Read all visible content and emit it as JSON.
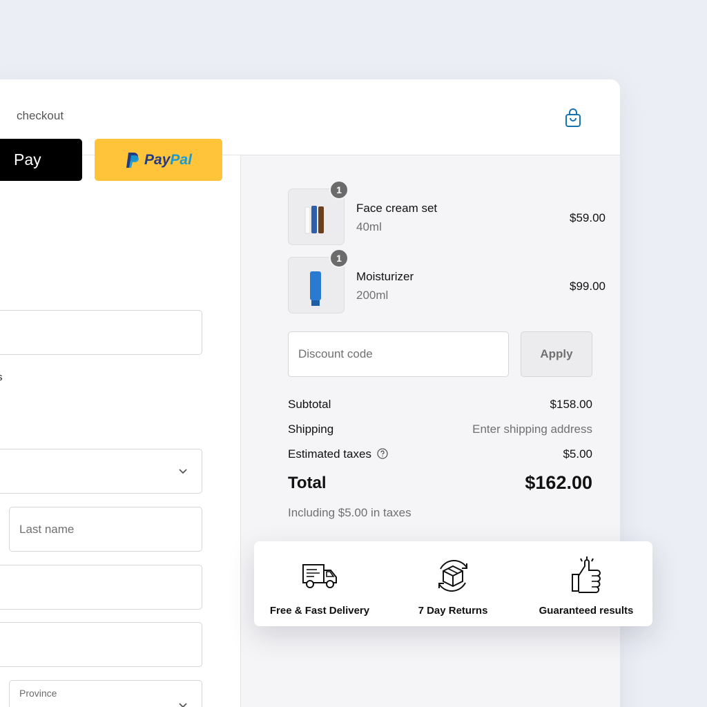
{
  "express": {
    "label": "checkout",
    "apple_pay_label": "Pay",
    "paypal_label_1": "Pay",
    "paypal_label_2": "Pal"
  },
  "form": {
    "newsletter_fragment": "s",
    "last_name_placeholder": "Last name",
    "province_label": "Province"
  },
  "cart": {
    "items": [
      {
        "name": "Face cream set",
        "variant": "40ml",
        "price": "$59.00",
        "quantity": "1"
      },
      {
        "name": "Moisturizer",
        "variant": "200ml",
        "price": "$99.00",
        "quantity": "1"
      }
    ]
  },
  "discount": {
    "placeholder": "Discount code",
    "apply_label": "Apply"
  },
  "summary": {
    "subtotal_label": "Subtotal",
    "subtotal_value": "$158.00",
    "shipping_label": "Shipping",
    "shipping_value": "Enter shipping address",
    "taxes_label": "Estimated taxes",
    "taxes_value": "$5.00",
    "total_label": "Total",
    "total_value": "$162.00",
    "tax_note": "Including $5.00 in taxes"
  },
  "benefits": [
    {
      "label": "Free & Fast Delivery",
      "icon": "delivery-truck-icon"
    },
    {
      "label": "7 Day Returns",
      "icon": "returns-box-icon"
    },
    {
      "label": "Guaranteed results",
      "icon": "thumbs-up-icon"
    }
  ],
  "colors": {
    "accent": "#1773b0",
    "paypal_yellow": "#ffc439",
    "paypal_dark_blue": "#253b80",
    "paypal_light_blue": "#179bd7",
    "summary_bg": "#f5f4f6",
    "page_bg": "#eceef5"
  }
}
